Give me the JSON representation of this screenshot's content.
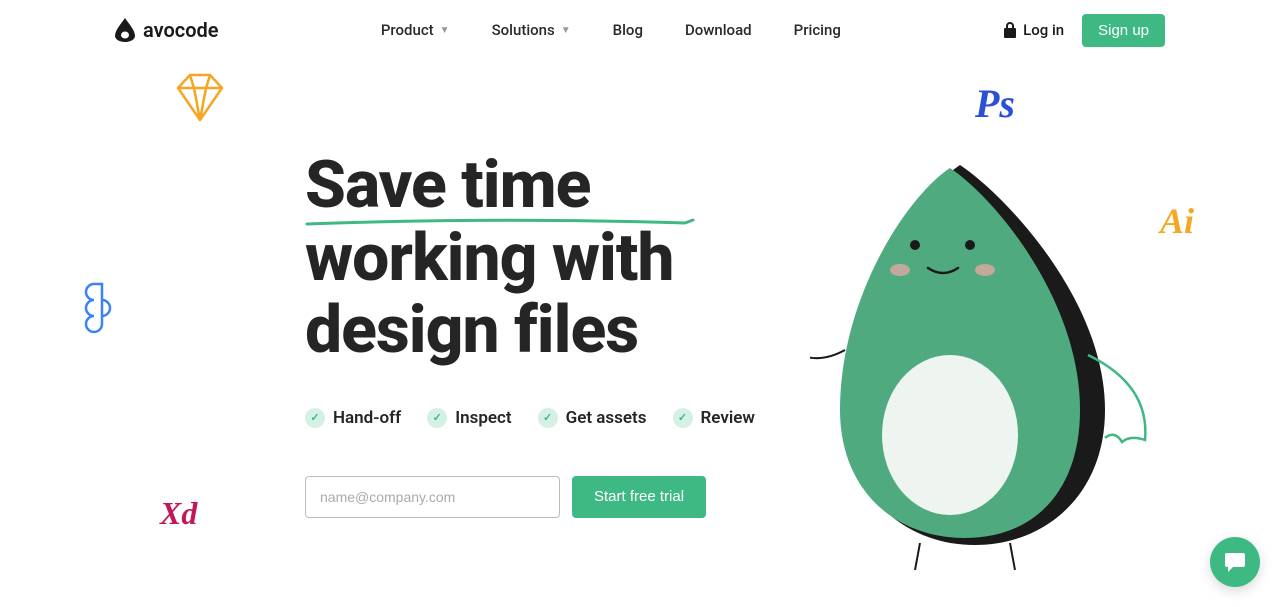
{
  "brand": "avocode",
  "nav": {
    "product": "Product",
    "solutions": "Solutions",
    "blog": "Blog",
    "download": "Download",
    "pricing": "Pricing"
  },
  "auth": {
    "login": "Log in",
    "signup": "Sign up"
  },
  "hero": {
    "headline_line1": "Save time",
    "headline_line2": "working with",
    "headline_line3": "design files"
  },
  "features": {
    "f1": "Hand-off",
    "f2": "Inspect",
    "f3": "Get assets",
    "f4": "Review"
  },
  "cta": {
    "email_placeholder": "name@company.com",
    "button": "Start free trial"
  },
  "doodles": {
    "xd": "Xd",
    "ps": "Ps",
    "ai": "Ai"
  }
}
